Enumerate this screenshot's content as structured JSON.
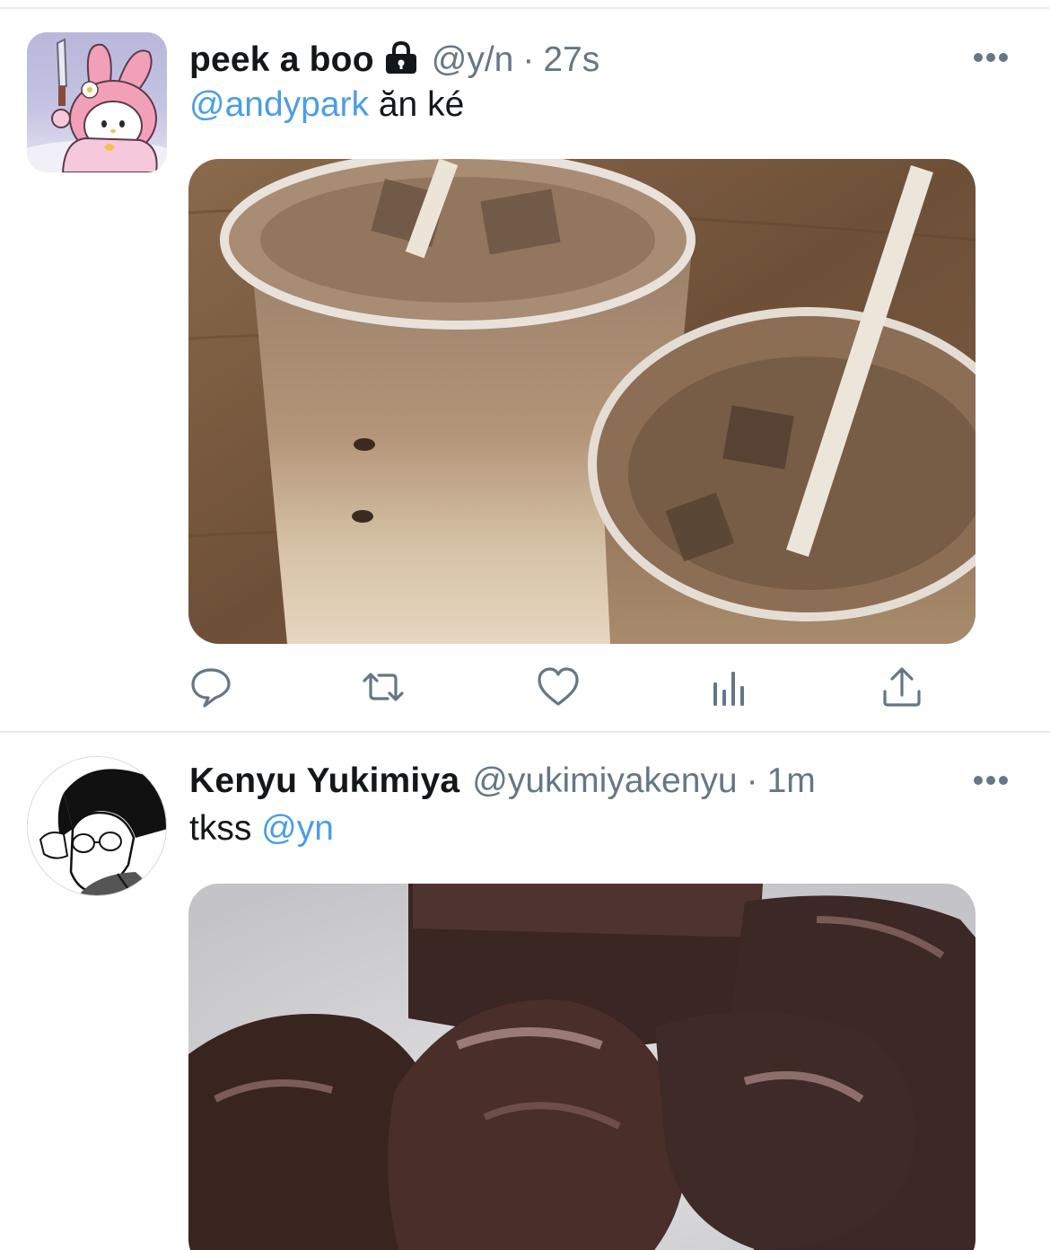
{
  "tweets": [
    {
      "display_name": "peek a boo",
      "handle": "@y/n",
      "separator": "·",
      "time": "27s",
      "text_mention": "@andypark",
      "text_body": " ăn ké",
      "locked": true,
      "avatar_icon": "my-melody-avatar-icon",
      "media_description": "iced-coffee-photo"
    },
    {
      "display_name": "Kenyu Yukimiya",
      "handle": "@yukimiyakenyu",
      "separator": "·",
      "time": "1m",
      "text_body": "tkss ",
      "text_mention": "@yn",
      "avatar_icon": "anime-boy-avatar-icon",
      "media_description": "brownies-photo"
    }
  ],
  "actions": {
    "reply_icon": "reply-icon",
    "retweet_icon": "retweet-icon",
    "like_icon": "heart-icon",
    "analytics_icon": "analytics-icon",
    "share_icon": "share-icon"
  },
  "colors": {
    "mention": "#4a9ee6",
    "secondary_text": "#657786",
    "primary_text": "#14171a",
    "divider": "#e6ecf0",
    "icon": "#657786"
  }
}
